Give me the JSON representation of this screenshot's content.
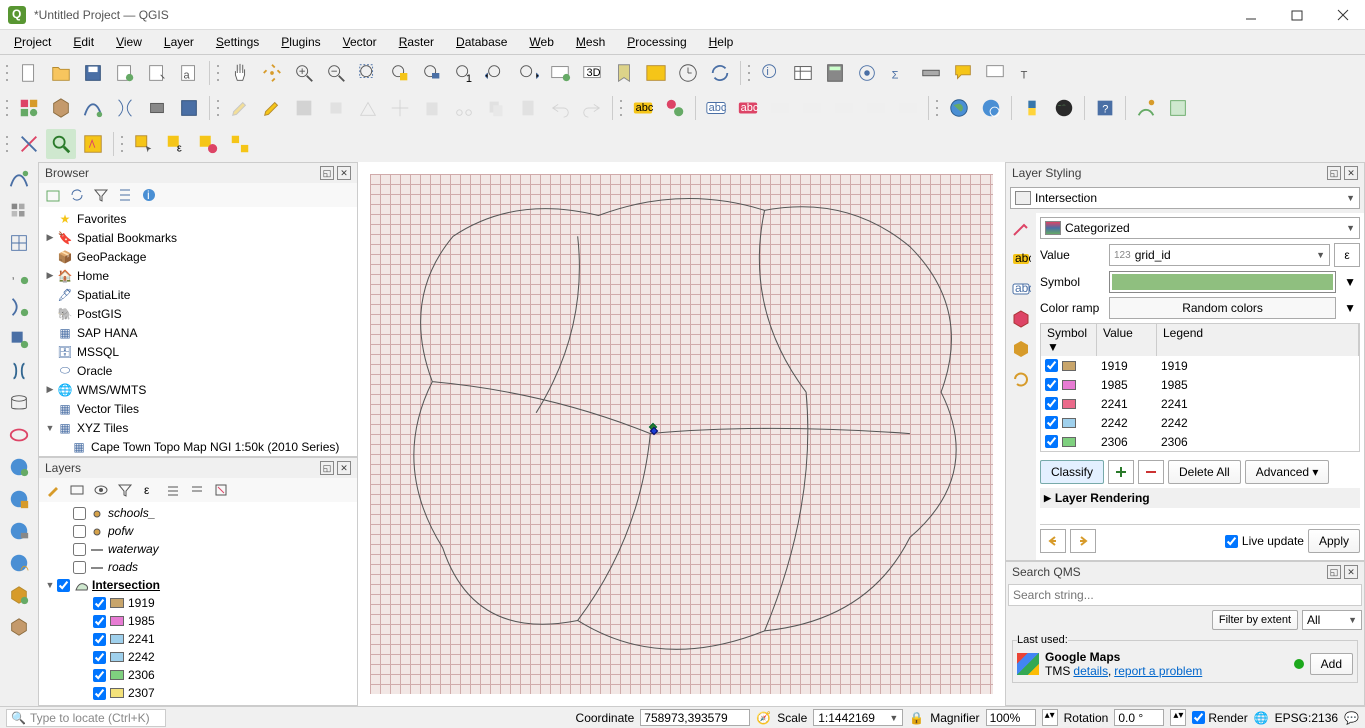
{
  "window": {
    "title": "*Untitled Project — QGIS"
  },
  "menu": [
    "Project",
    "Edit",
    "View",
    "Layer",
    "Settings",
    "Plugins",
    "Vector",
    "Raster",
    "Database",
    "Web",
    "Mesh",
    "Processing",
    "Help"
  ],
  "browser": {
    "title": "Browser",
    "items": [
      {
        "exp": "",
        "icon": "star",
        "label": "Favorites",
        "color": "#f5c518"
      },
      {
        "exp": "▶",
        "icon": "bookmark",
        "label": "Spatial Bookmarks"
      },
      {
        "exp": "",
        "icon": "geopackage",
        "label": "GeoPackage"
      },
      {
        "exp": "▶",
        "icon": "home",
        "label": "Home"
      },
      {
        "exp": "",
        "icon": "spatialite",
        "label": "SpatiaLite"
      },
      {
        "exp": "",
        "icon": "postgis",
        "label": "PostGIS"
      },
      {
        "exp": "",
        "icon": "saphana",
        "label": "SAP HANA"
      },
      {
        "exp": "",
        "icon": "mssql",
        "label": "MSSQL"
      },
      {
        "exp": "",
        "icon": "oracle",
        "label": "Oracle"
      },
      {
        "exp": "▶",
        "icon": "wms",
        "label": "WMS/WMTS"
      },
      {
        "exp": "",
        "icon": "tiles",
        "label": "Vector Tiles"
      },
      {
        "exp": "▼",
        "icon": "xyz",
        "label": "XYZ Tiles"
      },
      {
        "exp": "",
        "icon": "grid",
        "label": "Cape Town Topo Map NGI 1:50k (2010 Series)",
        "indent": 1
      }
    ]
  },
  "layers": {
    "title": "Layers",
    "items": [
      {
        "checked": false,
        "sym": "point",
        "color": "#d6a24a",
        "name": "schools_",
        "italic": true,
        "indent": 1
      },
      {
        "checked": false,
        "sym": "point",
        "color": "#d6a24a",
        "name": "pofw",
        "italic": true,
        "indent": 1
      },
      {
        "checked": false,
        "sym": "line",
        "color": "#888",
        "name": "waterway",
        "italic": true,
        "indent": 1
      },
      {
        "checked": false,
        "sym": "line",
        "color": "#888",
        "name": "roads",
        "italic": true,
        "indent": 1
      },
      {
        "checked": true,
        "sym": "poly",
        "color": "#cfe8cf",
        "name": "Intersection",
        "group": true,
        "exp": "▼"
      },
      {
        "checked": true,
        "sym": "fill",
        "color": "#c8a56b",
        "name": "1919",
        "indent": 2
      },
      {
        "checked": true,
        "sym": "fill",
        "color": "#e77bd3",
        "name": "1985",
        "indent": 2
      },
      {
        "checked": true,
        "sym": "fill",
        "color": "#9fd0ec",
        "name": "2241",
        "indent": 2
      },
      {
        "checked": true,
        "sym": "fill",
        "color": "#9fd0ec",
        "name": "2242",
        "indent": 2
      },
      {
        "checked": true,
        "sym": "fill",
        "color": "#7fd07f",
        "name": "2306",
        "indent": 2
      },
      {
        "checked": true,
        "sym": "fill",
        "color": "#f4e27a",
        "name": "2307",
        "indent": 2
      }
    ]
  },
  "styling": {
    "title": "Layer Styling",
    "layer_combo": "Intersection",
    "renderer": "Categorized",
    "value_label": "Value",
    "value_field": "grid_id",
    "value_prefix": "123",
    "symbol_label": "Symbol",
    "ramp_label": "Color ramp",
    "ramp_value": "Random colors",
    "cols": {
      "sym": "Symbol",
      "val": "Value",
      "leg": "Legend"
    },
    "rows": [
      {
        "checked": true,
        "color": "#c8a56b",
        "value": "1919",
        "legend": "1919"
      },
      {
        "checked": true,
        "color": "#e77bd3",
        "value": "1985",
        "legend": "1985"
      },
      {
        "checked": true,
        "color": "#ea6a8a",
        "value": "2241",
        "legend": "2241"
      },
      {
        "checked": true,
        "color": "#9fd0ec",
        "value": "2242",
        "legend": "2242"
      },
      {
        "checked": true,
        "color": "#7fd07f",
        "value": "2306",
        "legend": "2306"
      }
    ],
    "classify": "Classify",
    "delete_all": "Delete All",
    "advanced": "Advanced",
    "layer_rendering": "Layer Rendering",
    "live_update": "Live update",
    "apply": "Apply",
    "epsilon_tip": "ε"
  },
  "qms": {
    "title": "Search QMS",
    "placeholder": "Search string...",
    "filter_extent": "Filter by extent",
    "all": "All",
    "last_used": "Last used:",
    "google_maps": "Google Maps",
    "tms": "TMS",
    "details": "details",
    "report": "report a problem",
    "add": "Add"
  },
  "status": {
    "locator_placeholder": "Type to locate (Ctrl+K)",
    "coord_label": "Coordinate",
    "coord": "758973,393579",
    "scale_label": "Scale",
    "scale": "1:1442169",
    "magnifier_label": "Magnifier",
    "magnifier": "100%",
    "rotation_label": "Rotation",
    "rotation": "0.0 °",
    "render": "Render",
    "epsg": "EPSG:2136"
  }
}
